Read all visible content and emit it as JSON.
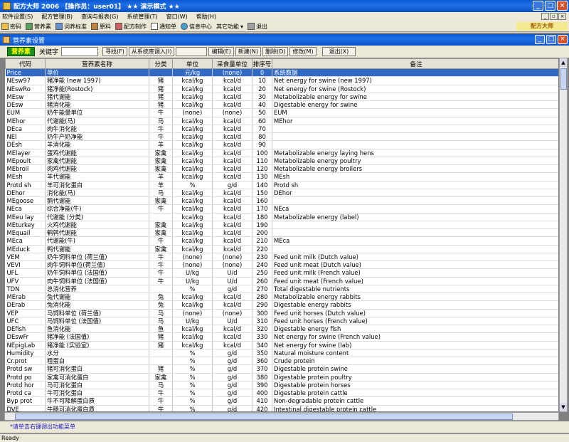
{
  "app": {
    "title": "配方大师 2006 【操作员：user01】 ★★ 演示模式 ★★"
  },
  "menu": [
    "软件设置(S)",
    "配方管理(B)",
    "查询与报表(G)",
    "系统管理(T)",
    "窗口(W)",
    "帮助(H)"
  ],
  "toolbar": {
    "items": [
      "密码",
      "营养素",
      "词养标准",
      "原料",
      "配方制作",
      "通知单",
      "信息中心",
      "其它功能",
      "退出"
    ],
    "brand": "配方大师"
  },
  "child_window": {
    "title": "营养素设置"
  },
  "search": {
    "tag": "营养素",
    "keyword_label": "关键字",
    "find": "寻找(F)",
    "import": "从系统库调入(I)",
    "edit": "编辑(E)",
    "new": "新建(N)",
    "delete": "删除(D)",
    "modify": "修改(M)",
    "exit": "退出(X)"
  },
  "table": {
    "headers": [
      "代码",
      "营养素名称",
      "分类",
      "单位",
      "采食量单位",
      "排序号",
      "备注"
    ],
    "rows": [
      [
        "Price",
        "单价",
        "",
        "元/kg",
        "(none)",
        "0",
        "系统数据"
      ],
      [
        "NEsw97",
        "猪净能 (new 1997)",
        "猪",
        "kcal/kg",
        "kcal/d",
        "10",
        "Net energy for swine (new 1997)"
      ],
      [
        "NEswRo",
        "猪净能(Rostock)",
        "猪",
        "kcal/kg",
        "kcal/d",
        "20",
        "Net energy for swine (Rostock)"
      ],
      [
        "MEsw",
        "猪代谢能",
        "猪",
        "kcal/kg",
        "kcal/d",
        "30",
        "Metabolizable energy for swine"
      ],
      [
        "DEsw",
        "猪消化能",
        "猪",
        "kcal/kg",
        "kcal/d",
        "40",
        "Digestable energy for swine"
      ],
      [
        "EUM",
        "奶牛能量单位",
        "牛",
        "(none)",
        "(none)",
        "50",
        "EUM"
      ],
      [
        "MEhor",
        "代谢能(马)",
        "马",
        "kcal/kg",
        "kcal/d",
        "60",
        "MEhor"
      ],
      [
        "DEca",
        "肉牛消化能",
        "牛",
        "kcal/kg",
        "kcal/d",
        "70",
        ""
      ],
      [
        "NEl",
        "奶牛产奶净能",
        "牛",
        "kcal/kg",
        "kcal/d",
        "80",
        ""
      ],
      [
        "DEsh",
        "羊消化能",
        "羊",
        "kcal/kg",
        "kcal/d",
        "90",
        ""
      ],
      [
        "MElayer",
        "蛋鸡代谢能",
        "家禽",
        "kcal/kg",
        "kcal/d",
        "100",
        "Metabolizable energy laying hens"
      ],
      [
        "MEpoult",
        "家禽代谢能",
        "家禽",
        "kcal/kg",
        "kcal/d",
        "110",
        "Metabolizable energy poultry"
      ],
      [
        "MEbroil",
        "肉鸡代谢能",
        "家禽",
        "kcal/kg",
        "kcal/d",
        "120",
        "Metabolizable energy broilers"
      ],
      [
        "MEsh",
        "羊代谢能",
        "羊",
        "kcal/kg",
        "kcal/d",
        "130",
        "MEsh"
      ],
      [
        "Protd sh",
        "羊可消化蛋白",
        "羊",
        "%",
        "g/d",
        "140",
        "Protd sh"
      ],
      [
        "DEhor",
        "消化能(马)",
        "马",
        "kcal/kg",
        "kcal/d",
        "150",
        "DEhor"
      ],
      [
        "MEgoose",
        "鹅代谢能",
        "家禽",
        "kcal/kg",
        "kcal/d",
        "160",
        ""
      ],
      [
        "NEca",
        "综合净能(牛)",
        "牛",
        "kcal/kg",
        "kcal/d",
        "170",
        "NEca"
      ],
      [
        "MEeu lay",
        "代谢能 (分类)",
        "",
        "kcal/kg",
        "kcal/d",
        "180",
        "Metabolizable energy (label)"
      ],
      [
        "MEturkey",
        "火鸡代谢能",
        "家禽",
        "kcal/kg",
        "kcal/d",
        "190",
        ""
      ],
      [
        "MEquail",
        "鹌鹑代谢能",
        "家禽",
        "kcal/kg",
        "kcal/d",
        "200",
        ""
      ],
      [
        "MEca",
        "代谢能(牛)",
        "牛",
        "kcal/kg",
        "kcal/d",
        "210",
        "MEca"
      ],
      [
        "MEduck",
        "鸭代谢能",
        "家禽",
        "kcal/kg",
        "kcal/d",
        "220",
        ""
      ],
      [
        "VEM",
        "奶牛饲料单位 (荷兰值)",
        "牛",
        "(none)",
        "(none)",
        "230",
        "Feed unit milk (Dutch value)"
      ],
      [
        "VEVI",
        "肉牛饲料单位(荷兰值)",
        "牛",
        "(none)",
        "(none)",
        "240",
        "Feed unit meat (Dutch value)"
      ],
      [
        "UFL",
        "奶牛饲料单位 (法国值)",
        "牛",
        "U/kg",
        "U/d",
        "250",
        "Feed unit milk (French value)"
      ],
      [
        "UFV",
        "肉牛饲料单位 (法国值)",
        "牛",
        "U/kg",
        "U/d",
        "260",
        "Feed unit meat (French value)"
      ],
      [
        "TDN",
        "总消化营养",
        "",
        "%",
        "g/d",
        "270",
        "Total digestable nutrients"
      ],
      [
        "MErab",
        "兔代谢能",
        "兔",
        "kcal/kg",
        "kcal/d",
        "280",
        "Metabolizable energy rabbits"
      ],
      [
        "DErab",
        "兔消化能",
        "兔",
        "kcal/kg",
        "kcal/d",
        "290",
        "Digestable energy rabbits"
      ],
      [
        "VEP",
        "马饲料单位 (荷兰值)",
        "马",
        "(none)",
        "(none)",
        "300",
        "Feed unit horses (Dutch value)"
      ],
      [
        "UFC",
        "马饲料单位 (法国值)",
        "马",
        "U/kg",
        "U/d",
        "310",
        "Feed unit horses (French value)"
      ],
      [
        "DEfish",
        "鱼消化能",
        "鱼",
        "kcal/kg",
        "kcal/d",
        "320",
        "Digestable energy fish"
      ],
      [
        "DEswFr",
        "猪净能 (法国值)",
        "猪",
        "kcal/kg",
        "kcal/d",
        "330",
        "Net energy for swine (French value)"
      ],
      [
        "NEpigLab",
        "猪净能 (实验室)",
        "猪",
        "kcal/kg",
        "kcal/d",
        "340",
        "Net energy for swine (lab)"
      ],
      [
        "Humidity",
        "水分",
        "",
        "%",
        "g/d",
        "350",
        "Natural moisture content"
      ],
      [
        "Cr.prot",
        "粗蛋白",
        "",
        "%",
        "g/d",
        "360",
        "Crude protein"
      ],
      [
        "Protd sw",
        "猪可消化蛋白",
        "猪",
        "%",
        "g/d",
        "370",
        "Digestable protein swine"
      ],
      [
        "Protd po",
        "家禽可消化蛋白",
        "家禽",
        "%",
        "g/d",
        "380",
        "Digestable protein poultry"
      ],
      [
        "Protd hor",
        "马可消化蛋白",
        "马",
        "%",
        "g/d",
        "390",
        "Digestable protein horses"
      ],
      [
        "Protd ca",
        "牛可消化蛋白",
        "牛",
        "%",
        "g/d",
        "400",
        "Digestable protein cattle"
      ],
      [
        "Byp prot",
        "牛不可降解蛋白质",
        "牛",
        "%",
        "g/d",
        "410",
        "Non-degradable protein cattle"
      ],
      [
        "DVE",
        "牛肠可消化蛋白质",
        "牛",
        "%",
        "g/d",
        "420",
        "Intestinal digestable protein cattle"
      ]
    ]
  },
  "hint": "*请单击右键调出功能菜单",
  "status": "Ready",
  "colors": {
    "titlebar": "#0a58d0",
    "selection": "#316ac5",
    "tag_bg": "#1c8c1c",
    "tag_fg": "#ffff00",
    "hint": "#1c1cc0"
  }
}
